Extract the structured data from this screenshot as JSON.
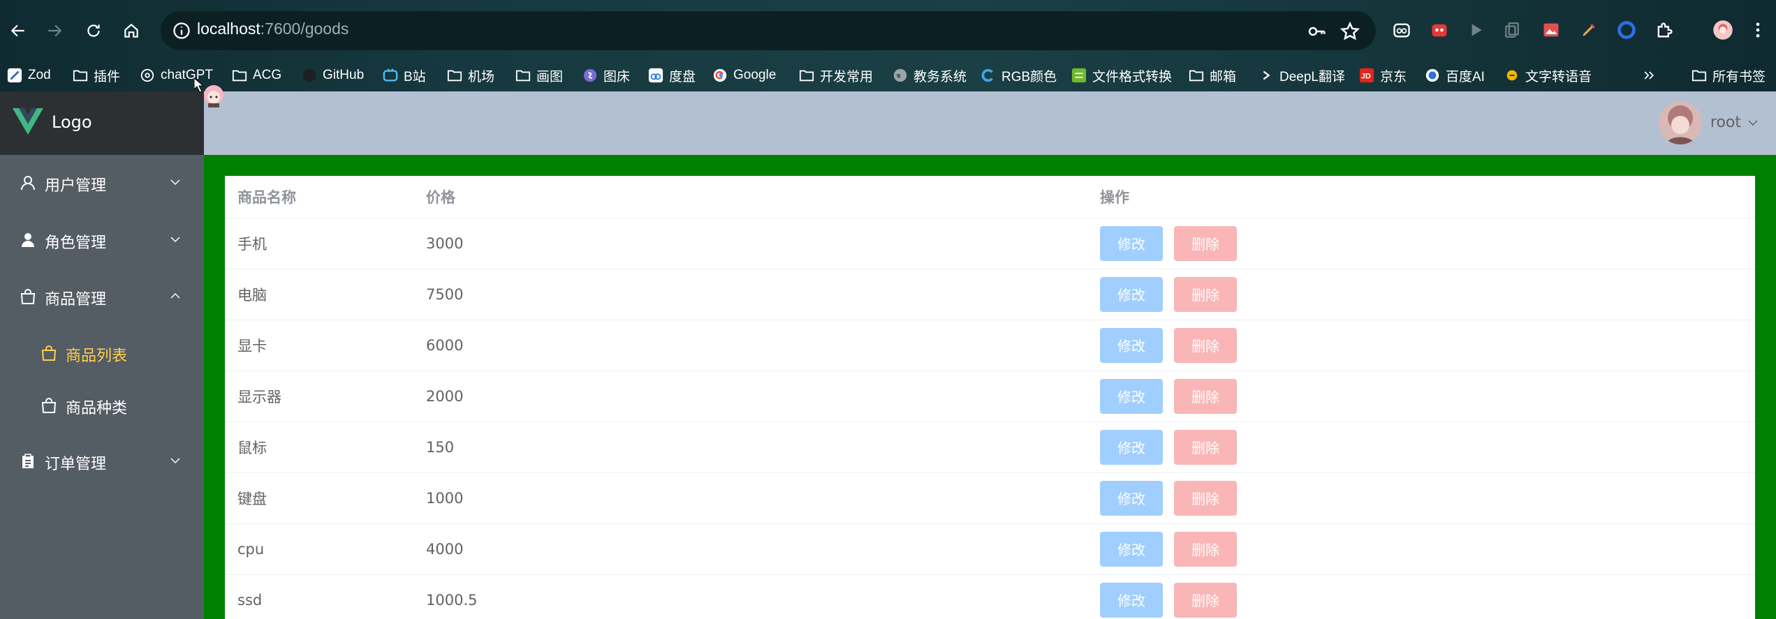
{
  "browser": {
    "url_host": "localhost",
    "url_path": ":7600/goods",
    "bookmarks": [
      {
        "label": "Zod",
        "icon": "zod-icon"
      },
      {
        "label": "插件",
        "icon": "folder-icon"
      },
      {
        "label": "chatGPT",
        "icon": "openai-icon"
      },
      {
        "label": "ACG",
        "icon": "folder-icon"
      },
      {
        "label": "GitHub",
        "icon": "github-icon"
      },
      {
        "label": "B站",
        "icon": "bilibili-icon"
      },
      {
        "label": "机场",
        "icon": "folder-icon"
      },
      {
        "label": "画图",
        "icon": "folder-icon"
      },
      {
        "label": "图床",
        "icon": "picbed-icon"
      },
      {
        "label": "度盘",
        "icon": "baidu-pan-icon"
      },
      {
        "label": "Google",
        "icon": "google-icon"
      },
      {
        "label": "开发常用",
        "icon": "folder-icon"
      },
      {
        "label": "教务系统",
        "icon": "globe-icon"
      },
      {
        "label": "RGB颜色",
        "icon": "rgb-icon"
      },
      {
        "label": "文件格式转换",
        "icon": "convert-icon"
      },
      {
        "label": "邮箱",
        "icon": "folder-icon"
      },
      {
        "label": "DeepL翻译",
        "icon": "deepl-icon"
      },
      {
        "label": "京东",
        "icon": "jd-icon"
      },
      {
        "label": "百度AI",
        "icon": "baidu-ai-icon"
      },
      {
        "label": "文字转语音",
        "icon": "tts-icon"
      }
    ],
    "all_bookmarks_label": "所有书签"
  },
  "sidebar": {
    "logo_text": "Logo",
    "menu": [
      {
        "label": "用户管理",
        "icon": "user-outline-icon",
        "expanded": false
      },
      {
        "label": "角色管理",
        "icon": "user-solid-icon",
        "expanded": false
      },
      {
        "label": "商品管理",
        "icon": "shopping-bag-icon",
        "expanded": true
      },
      {
        "label": "商品列表",
        "icon": "shopping-bag-icon",
        "active": true
      },
      {
        "label": "商品种类",
        "icon": "shopping-bag-icon",
        "active": false
      },
      {
        "label": "订单管理",
        "icon": "clipboard-icon",
        "expanded": false
      }
    ],
    "active_color": "#ffd04b"
  },
  "header": {
    "username": "root"
  },
  "table": {
    "columns": [
      "商品名称",
      "价格",
      "操作"
    ],
    "edit_label": "修改",
    "delete_label": "删除",
    "rows": [
      {
        "name": "手机",
        "price": "3000"
      },
      {
        "name": "电脑",
        "price": "7500"
      },
      {
        "name": "显卡",
        "price": "6000"
      },
      {
        "name": "显示器",
        "price": "2000"
      },
      {
        "name": "鼠标",
        "price": "150"
      },
      {
        "name": "键盘",
        "price": "1000"
      },
      {
        "name": "cpu",
        "price": "4000"
      },
      {
        "name": "ssd",
        "price": "1000.5"
      }
    ]
  },
  "colors": {
    "main_background": "#008000",
    "header_background": "#b3c0d1",
    "sidebar_background": "#545c64",
    "edit_button": "#a0cfff",
    "delete_button": "#fab6b6"
  }
}
